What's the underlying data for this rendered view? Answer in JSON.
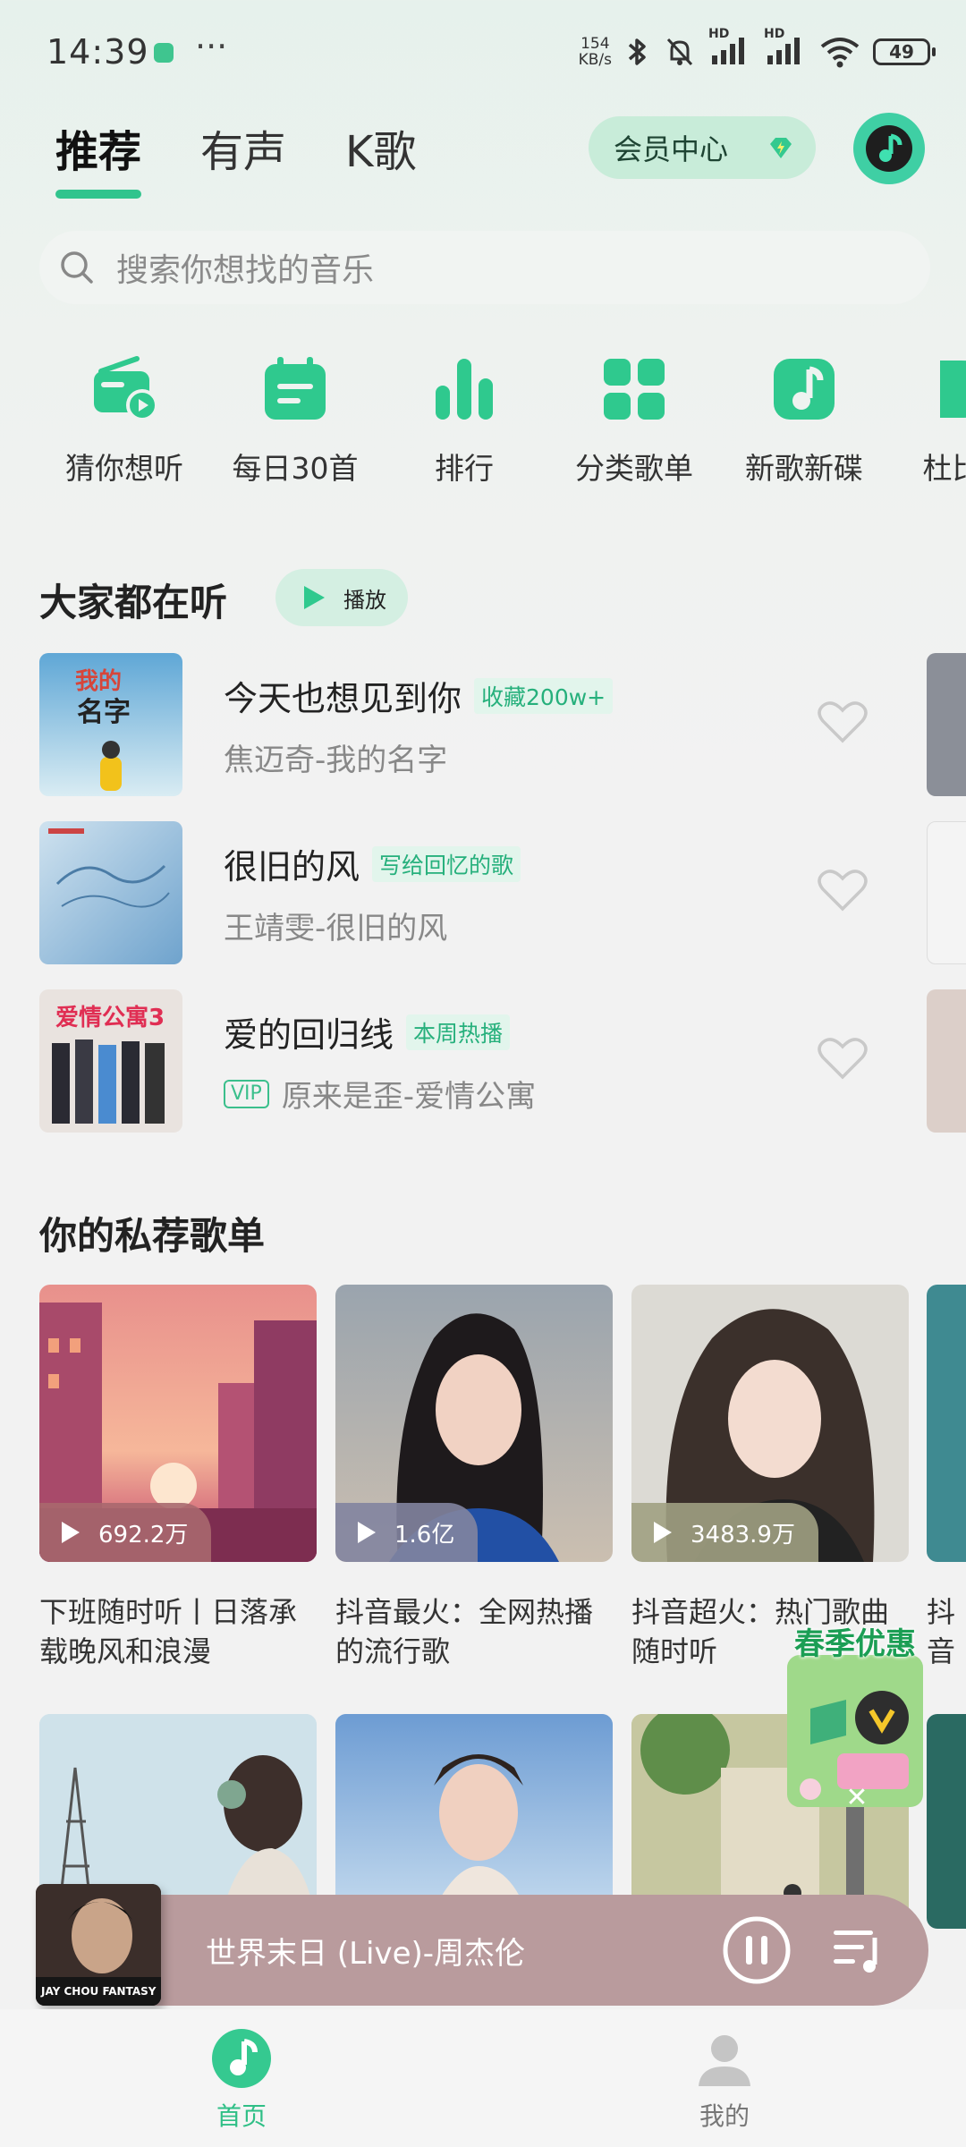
{
  "status_bar": {
    "time": "14:39",
    "network_speed_value": "154",
    "network_speed_unit": "KB/s",
    "signal1_label": "HD",
    "signal2_label": "HD",
    "battery": "49",
    "more": "···"
  },
  "tabs": [
    {
      "label": "推荐",
      "active": true
    },
    {
      "label": "有声",
      "active": false
    },
    {
      "label": "K歌",
      "active": false
    }
  ],
  "vip_center_label": "会员中心",
  "search": {
    "placeholder": "搜索你想找的音乐"
  },
  "quick_nav": [
    {
      "label": "猜你想听",
      "icon": "radio-icon"
    },
    {
      "label": "每日30首",
      "icon": "calendar-icon"
    },
    {
      "label": "排行",
      "icon": "chart-icon"
    },
    {
      "label": "分类歌单",
      "icon": "grid-icon"
    },
    {
      "label": "新歌新碟",
      "icon": "music-note-icon"
    },
    {
      "label": "杜比全",
      "icon": "dolby-icon"
    }
  ],
  "popular": {
    "title": "大家都在听",
    "play_label": "播放",
    "songs": [
      {
        "title": "今天也想见到你",
        "tag": "收藏200w+",
        "vip": false,
        "artist": "焦迈奇-我的名字"
      },
      {
        "title": "很旧的风",
        "tag": "写给回忆的歌",
        "vip": false,
        "artist": "王靖雯-很旧的风"
      },
      {
        "title": "爱的回归线",
        "tag": "本周热播",
        "vip": true,
        "vip_label": "VIP",
        "artist": "原来是歪-爱情公寓"
      }
    ]
  },
  "private_playlists": {
    "title": "你的私荐歌单",
    "items": [
      {
        "count": "692.2万",
        "name": "下班随时听丨日落承载晚风和浪漫"
      },
      {
        "count": "1.6亿",
        "name": "抖音最火：全网热播的流行歌"
      },
      {
        "count": "3483.9万",
        "name": "抖音超火：热门歌曲随时听"
      },
      {
        "name": "抖音沦陷"
      }
    ]
  },
  "promo": {
    "label": "春季优惠"
  },
  "player": {
    "now_playing": "世界末日 (Live)-周杰伦",
    "cover_text": "JAY CHOU FANTASY"
  },
  "bottom_nav": [
    {
      "label": "首页",
      "active": true
    },
    {
      "label": "我的",
      "active": false
    }
  ],
  "colors": {
    "accent": "#31c48d",
    "player_bg": "#b99b9d"
  }
}
